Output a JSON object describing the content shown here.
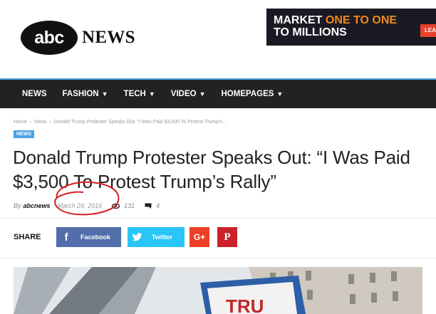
{
  "header": {
    "logo_abc": "abc",
    "logo_news": "NEWS"
  },
  "ad": {
    "line1_prefix": "MARKET ",
    "line1_highlight": "ONE TO ONE",
    "line2": "TO MILLIONS",
    "button": "LEAR",
    "colors": {
      "background": "#1b1a24",
      "highlight": "#f08a1c",
      "button": "#e8412c"
    }
  },
  "nav": {
    "items": [
      {
        "label": "NEWS",
        "dropdown": false
      },
      {
        "label": "FASHION",
        "dropdown": true
      },
      {
        "label": "TECH",
        "dropdown": true
      },
      {
        "label": "VIDEO",
        "dropdown": true
      },
      {
        "label": "HOMEPAGES",
        "dropdown": true
      }
    ],
    "accent": "#4aa3df"
  },
  "breadcrumb": {
    "items": [
      "Home",
      "News",
      "Donald Trump Protester Speaks Out: \"I Was Paid $3,500 To Protest Trump's..."
    ]
  },
  "article": {
    "category": "NEWS",
    "title": "Donald Trump Protester Speaks Out: “I Was Paid $3,500 To Protest Trump’s Rally”",
    "by": "By",
    "author": "abcnews",
    "date": "March 24, 2016",
    "views": "131",
    "comments": "4"
  },
  "share": {
    "label": "SHARE",
    "facebook": "Facebook",
    "twitter": "Twitter",
    "googleplus_icon": "G+",
    "pinterest_icon": "P",
    "colors": {
      "facebook": "#516eab",
      "twitter": "#29c5f6",
      "googleplus": "#eb4026",
      "pinterest": "#ca212a"
    }
  },
  "hero": {
    "sign_text": "TRU"
  }
}
